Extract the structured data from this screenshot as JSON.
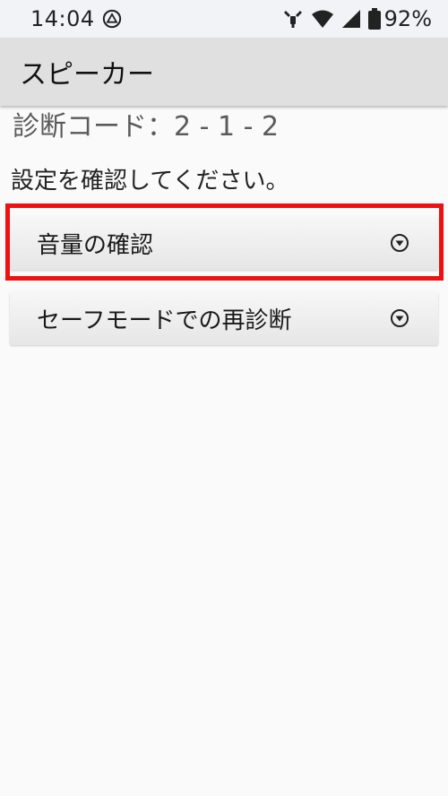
{
  "status_bar": {
    "time": "14:04",
    "battery_percent": "92%",
    "icons": [
      "drive-triangle-icon",
      "tools-icon",
      "wifi-icon",
      "cell-signal-icon",
      "battery-icon"
    ]
  },
  "app_bar": {
    "title": "スピーカー"
  },
  "content": {
    "diagnosis_code": "診断コード：2 - 1 - 2",
    "instruction": "設定を確認してください。"
  },
  "panels": [
    {
      "label": "音量の確認",
      "icon": "chevron-down-circle-icon"
    },
    {
      "label": "セーフモードでの再診断",
      "icon": "chevron-down-circle-icon"
    }
  ],
  "colors": {
    "highlight": "#ee1111",
    "app_bar": "#e0e0e0",
    "status_bar": "#f1f3f6",
    "background": "#fafafa"
  }
}
